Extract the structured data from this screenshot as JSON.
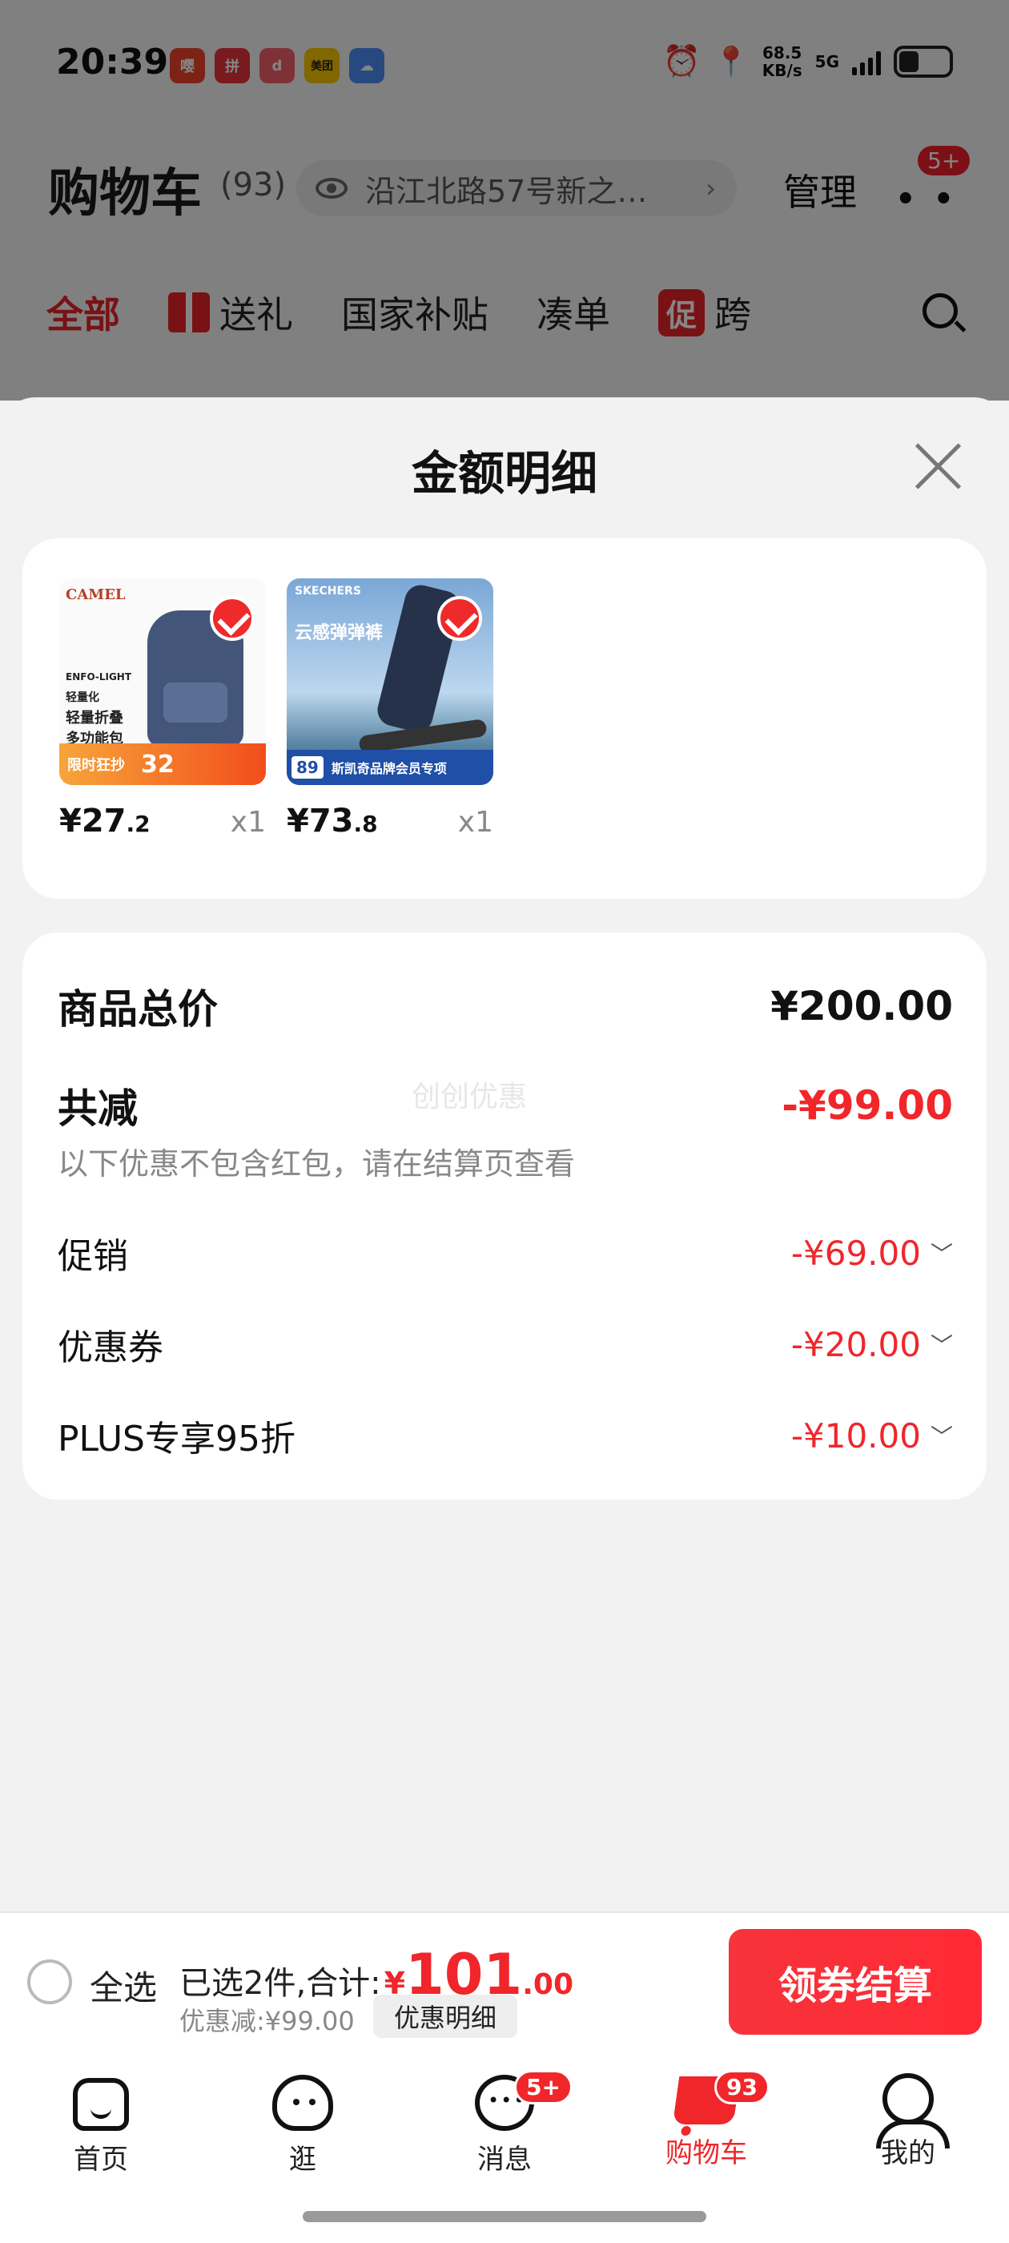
{
  "status_bar": {
    "time": "20:39",
    "net_speed": "68.5",
    "net_unit": "KB/s",
    "net_type": "5G",
    "apps": [
      "嘤",
      "拼",
      "d",
      "美团",
      "☁"
    ]
  },
  "header": {
    "title": "购物车",
    "count": "(93)",
    "address": "沿江北路57号新之…",
    "manage": "管理",
    "more_badge": "5+"
  },
  "tabs": [
    {
      "label": "全部",
      "active": true
    },
    {
      "label": "送礼"
    },
    {
      "label": "国家补贴"
    },
    {
      "label": "凑单"
    },
    {
      "label": "跨",
      "tag": "促"
    }
  ],
  "sheet": {
    "title": "金额明细",
    "products": [
      {
        "brand": "CAMEL",
        "lines": [
          "ENFO-LIGHT",
          "轻量化",
          "轻量折叠",
          "多功能包"
        ],
        "banner": "限时狂抄",
        "banner_num": "32",
        "price_int": "¥27",
        "price_dec": ".2",
        "qty": "x1"
      },
      {
        "brand": "SKECHERS",
        "headline": "云感弹弹裤",
        "footer": "斯凯奇品牌会员专项",
        "footer_price": "89",
        "price_int": "¥73",
        "price_dec": ".8",
        "qty": "x1"
      }
    ],
    "total_label": "商品总价",
    "total_value": "¥200.00",
    "reduce_label": "共减",
    "reduce_value": "-¥99.00",
    "note": "以下优惠不包含红包，请在结算页查看",
    "watermark": "创创优惠",
    "items": [
      {
        "label": "促销",
        "value": "-¥69.00"
      },
      {
        "label": "优惠券",
        "value": "-¥20.00"
      },
      {
        "label": "PLUS专享95折",
        "value": "-¥10.00"
      }
    ]
  },
  "bottom": {
    "select_all": "全选",
    "selected_text": "已选2件,合计:",
    "amount_symbol": "¥",
    "amount_int": "101",
    "amount_dec": ".00",
    "saved": "优惠减:¥99.00",
    "detail_button": "优惠明细",
    "checkout": "领券结算"
  },
  "nav": [
    {
      "label": "首页"
    },
    {
      "label": "逛"
    },
    {
      "label": "消息",
      "badge": "5+"
    },
    {
      "label": "购物车",
      "badge": "93",
      "active": true
    },
    {
      "label": "我的"
    }
  ]
}
